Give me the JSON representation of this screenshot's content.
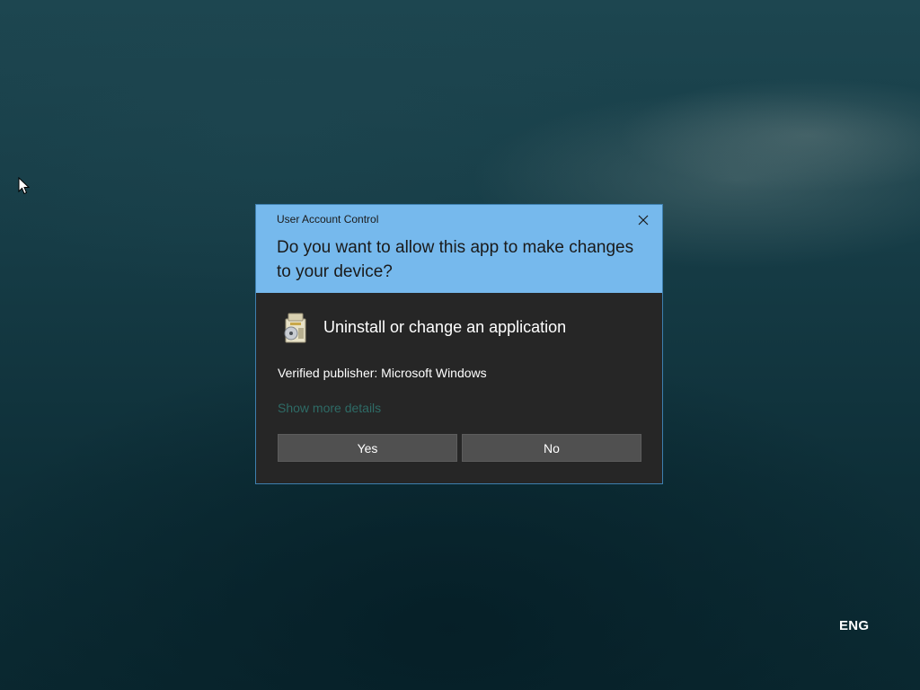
{
  "desktop": {
    "language_indicator": "ENG"
  },
  "uac": {
    "title": "User Account Control",
    "question": "Do you want to allow this app to make changes to your device?",
    "app_name": "Uninstall or change an application",
    "publisher": "Verified publisher: Microsoft Windows",
    "details_link": "Show more details",
    "yes_label": "Yes",
    "no_label": "No",
    "icons": {
      "close": "close-icon",
      "app": "program-installer-icon"
    }
  },
  "colors": {
    "header_background": "#76b9ed",
    "body_background": "#262626",
    "button_background": "#505050",
    "link_color": "#2e6b66"
  }
}
